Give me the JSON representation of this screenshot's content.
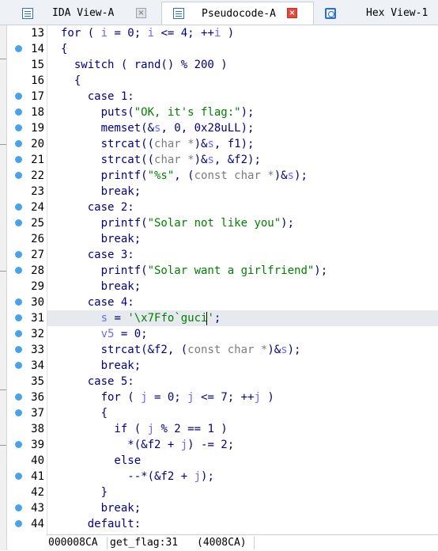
{
  "tabs": [
    {
      "label": "IDA View-A",
      "active": false,
      "icon": "list-view-icon"
    },
    {
      "label": "Pseudocode-A",
      "active": true,
      "icon": "pseudocode-icon"
    },
    {
      "label": "Hex View-1",
      "active": false,
      "icon": "hex-view-icon"
    }
  ],
  "code_lines": [
    {
      "n": "13",
      "dot": false,
      "html": "<span class='txt'>for ( </span><span class='var'>i</span><span class='txt'> = 0; </span><span class='var'>i</span><span class='txt'> &lt;= 4; ++</span><span class='var'>i</span><span class='txt'> )</span>"
    },
    {
      "n": "14",
      "dot": true,
      "html": "<span class='txt'>{</span>"
    },
    {
      "n": "15",
      "dot": false,
      "html": "<span class='txt'>  switch ( rand() % 200 )</span>"
    },
    {
      "n": "16",
      "dot": false,
      "html": "<span class='txt'>  {</span>"
    },
    {
      "n": "17",
      "dot": true,
      "html": "<span class='txt'>    case 1:</span>"
    },
    {
      "n": "18",
      "dot": true,
      "html": "<span class='txt'>      puts(</span><span class='str'>\"OK, it's flag:\"</span><span class='txt'>);</span>"
    },
    {
      "n": "19",
      "dot": true,
      "html": "<span class='txt'>      memset(&amp;</span><span class='var'>s</span><span class='txt'>, 0, 0x28uLL);</span>"
    },
    {
      "n": "20",
      "dot": true,
      "html": "<span class='txt'>      strcat((</span><span class='typ'>char *</span><span class='txt'>)&amp;</span><span class='var'>s</span><span class='txt'>, f1);</span>"
    },
    {
      "n": "21",
      "dot": true,
      "html": "<span class='txt'>      strcat((</span><span class='typ'>char *</span><span class='txt'>)&amp;</span><span class='var'>s</span><span class='txt'>, &amp;f2);</span>"
    },
    {
      "n": "22",
      "dot": true,
      "html": "<span class='txt'>      printf(</span><span class='str'>\"%s\"</span><span class='txt'>, (</span><span class='typ'>const char *</span><span class='txt'>)&amp;</span><span class='var'>s</span><span class='txt'>);</span>"
    },
    {
      "n": "23",
      "dot": false,
      "html": "<span class='txt'>      break;</span>"
    },
    {
      "n": "24",
      "dot": true,
      "html": "<span class='txt'>    case 2:</span>"
    },
    {
      "n": "25",
      "dot": true,
      "html": "<span class='txt'>      printf(</span><span class='str'>\"Solar not like you\"</span><span class='txt'>);</span>"
    },
    {
      "n": "26",
      "dot": false,
      "html": "<span class='txt'>      break;</span>"
    },
    {
      "n": "27",
      "dot": true,
      "html": "<span class='txt'>    case 3:</span>"
    },
    {
      "n": "28",
      "dot": true,
      "html": "<span class='txt'>      printf(</span><span class='str'>\"Solar want a girlfriend\"</span><span class='txt'>);</span>"
    },
    {
      "n": "29",
      "dot": false,
      "html": "<span class='txt'>      break;</span>"
    },
    {
      "n": "30",
      "dot": true,
      "html": "<span class='txt'>    case 4:</span>"
    },
    {
      "n": "31",
      "dot": true,
      "html": "<span class='txt'>      </span><span class='var'>s</span><span class='txt'> = </span><span class='str'>'\\x7Ffo`guci</span><span class='cursor'></span><span class='str'>'</span><span class='txt'>;</span>",
      "highlight": true
    },
    {
      "n": "32",
      "dot": true,
      "html": "<span class='txt'>      </span><span class='var'>v5</span><span class='txt'> = 0;</span>"
    },
    {
      "n": "33",
      "dot": true,
      "html": "<span class='txt'>      strcat(&amp;f2, (</span><span class='typ'>const char *</span><span class='txt'>)&amp;</span><span class='var'>s</span><span class='txt'>);</span>"
    },
    {
      "n": "34",
      "dot": true,
      "html": "<span class='txt'>      break;</span>"
    },
    {
      "n": "35",
      "dot": false,
      "html": "<span class='txt'>    case 5:</span>"
    },
    {
      "n": "36",
      "dot": true,
      "html": "<span class='txt'>      for ( </span><span class='var'>j</span><span class='txt'> = 0; </span><span class='var'>j</span><span class='txt'> &lt;= 7; ++</span><span class='var'>j</span><span class='txt'> )</span>"
    },
    {
      "n": "37",
      "dot": true,
      "html": "<span class='txt'>      {</span>"
    },
    {
      "n": "38",
      "dot": false,
      "html": "<span class='txt'>        if ( </span><span class='var'>j</span><span class='txt'> % 2 == 1 )</span>"
    },
    {
      "n": "39",
      "dot": true,
      "html": "<span class='txt'>          *(&amp;f2 + </span><span class='var'>j</span><span class='txt'>) -= 2;</span>"
    },
    {
      "n": "40",
      "dot": false,
      "html": "<span class='txt'>        else</span>"
    },
    {
      "n": "41",
      "dot": true,
      "html": "<span class='txt'>          --*(&amp;f2 + </span><span class='var'>j</span><span class='txt'>);</span>"
    },
    {
      "n": "42",
      "dot": false,
      "html": "<span class='txt'>      }</span>"
    },
    {
      "n": "43",
      "dot": true,
      "html": "<span class='txt'>      break;</span>"
    },
    {
      "n": "44",
      "dot": true,
      "html": "<span class='txt'>    default:</span>"
    }
  ],
  "status": {
    "address": "000008CA",
    "location": "get_flag:31",
    "ea": "(4008CA)"
  },
  "colors": {
    "keyword_text": "#000080",
    "string": "#008000",
    "variable": "#6a6aff",
    "type": "#7c7c7c",
    "breakpoint_dot": "#4aa3e8",
    "close_active": "#e8483c"
  }
}
